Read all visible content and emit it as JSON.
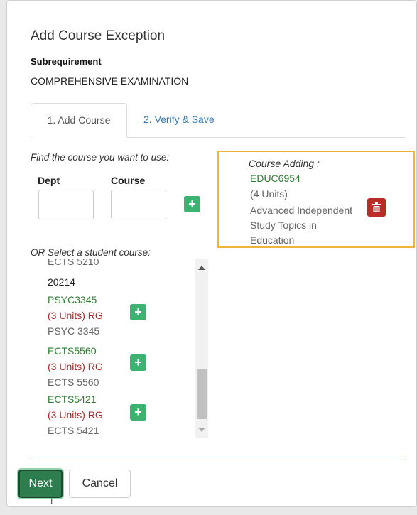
{
  "dialog": {
    "title": "Add Course Exception",
    "subrequirement_label": "Subrequirement",
    "subrequirement_value": "COMPREHENSIVE EXAMINATION"
  },
  "tabs": [
    {
      "label": "1. Add Course",
      "active": true
    },
    {
      "label": "2. Verify & Save",
      "active": false
    }
  ],
  "find": {
    "prompt": "Find the course you want to use:",
    "dept_label": "Dept",
    "course_label": "Course",
    "dept_value": "",
    "course_value": ""
  },
  "adding": {
    "title": "Course Adding :",
    "code": "EDUC6954",
    "units": "(4 Units)",
    "name": "Advanced Independent Study Topics in Education"
  },
  "student_courses": {
    "prompt": "OR Select a student course:",
    "partial_top": "ECTS 5210",
    "term": "20214",
    "items": [
      {
        "code": "PSYC3345",
        "units": "(3 Units)",
        "grade": "RG",
        "name": "PSYC 3345"
      },
      {
        "code": "ECTS5560",
        "units": "(3 Units)",
        "grade": "RG",
        "name": "ECTS 5560"
      },
      {
        "code": "ECTS5421",
        "units": "(3 Units)",
        "grade": "RG",
        "name": "ECTS 5421"
      }
    ]
  },
  "footer": {
    "next_label": "Next",
    "cancel_label": "Cancel"
  },
  "icons": {
    "plus": "plus-icon",
    "trash": "trash-icon"
  },
  "colors": {
    "accent_green": "#3cb371",
    "course_code_green": "#2e7d32",
    "delete_red": "#b92c28",
    "highlight_border": "#f0b63c",
    "link_blue": "#337ab7"
  }
}
